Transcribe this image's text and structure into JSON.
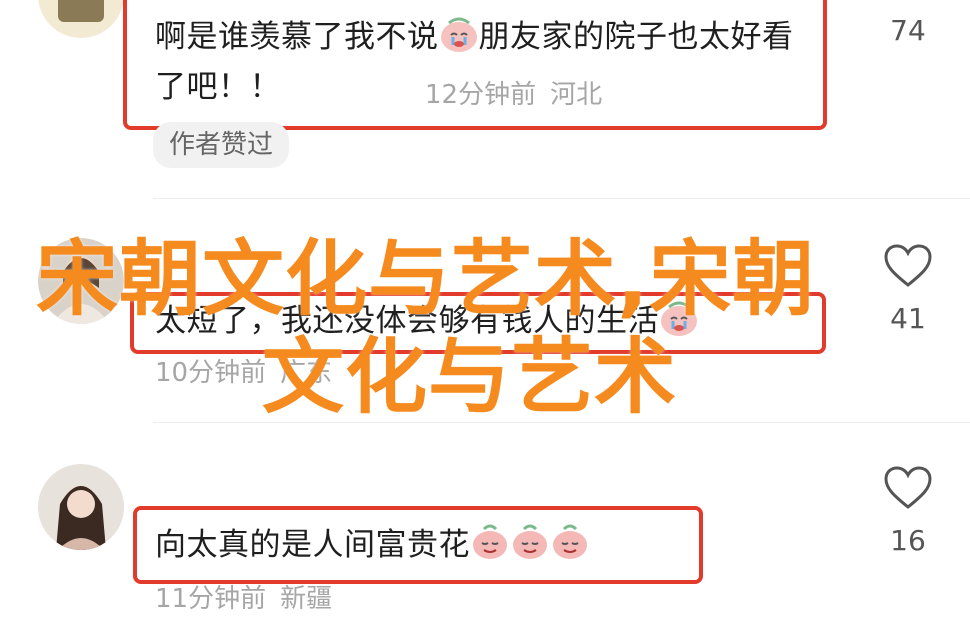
{
  "comments": [
    {
      "text_before_emoji": "啊是谁羡慕了我不说",
      "text_after_emoji": "朋友家的院子也太好看了吧！！",
      "time": "12分钟前",
      "location": "河北",
      "author_tag": "作者赞过",
      "likes": "74"
    },
    {
      "text": "太短了，我还没体会够有钱人的生活",
      "time": "10分钟前",
      "location": "广东",
      "likes": "41"
    },
    {
      "text": "向太真的是人间富贵花",
      "time": "11分钟前",
      "location": "新疆",
      "likes": "16"
    }
  ],
  "overlay": {
    "line1": "宋朝文化与艺术,宋朝",
    "line2": "文化与艺术"
  },
  "colors": {
    "highlight": "#e23b2b",
    "overlay_text": "#f58a1f",
    "meta_gray": "#a6a6a6"
  }
}
